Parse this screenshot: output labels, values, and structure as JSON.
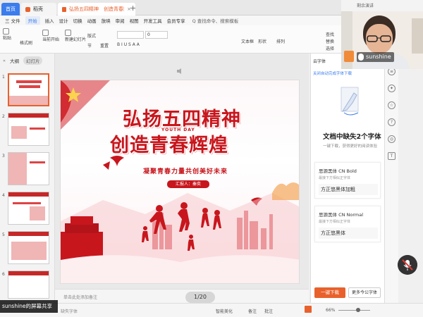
{
  "tabs": {
    "home": "首页",
    "docer": "稻壳",
    "doc": "弘扬五四精神　创造青春辉煌"
  },
  "tab_right": "剩余演讲",
  "menu": [
    "三 文件",
    "开始",
    "插入",
    "设计",
    "切换",
    "动画",
    "放映",
    "审阅",
    "视图",
    "开发工具",
    "会员专享"
  ],
  "menu_search": "Q 查找命令、搜索模板",
  "ribbon": {
    "paste": "粘贴",
    "format_brush": "格式刷",
    "from_current": "当前开始",
    "new_slide": "新建幻灯片",
    "layout": "版式",
    "section": "节",
    "reset": "重置",
    "font_size": "0",
    "textbox": "文本框",
    "shape": "形状",
    "arrange": "排列",
    "find": "查找",
    "replace": "替换",
    "select": "选择"
  },
  "side": {
    "outline": "大纲",
    "slides": "幻灯片"
  },
  "thumb_numbers": [
    "1",
    "2",
    "3",
    "4",
    "5",
    "6"
  ],
  "slide": {
    "title1": "弘扬五四精神",
    "title2": "创造青春辉煌",
    "youth": "YOUTH DAY",
    "subtitle": "凝聚青春力量共创美好未来",
    "reporter": "汇报人：秦奕"
  },
  "note_placeholder": "单击此处添加备注",
  "page_counter": "1/20",
  "status": {
    "missing_font": "缺失字体",
    "beautify": "智能美化",
    "notes": "备注",
    "annot": "批注",
    "zoom": "66%"
  },
  "screen_share": "sunshine的屏幕共享",
  "right_panel": {
    "header": "云字体",
    "link": "关闭自动完成字体下载",
    "title": "文档中缺失2个字体",
    "subtitle": "一键下载，获得更好的阅读体验",
    "fonts": [
      {
        "name": "思源黑体 CN Bold",
        "hint": "最接下方相似正字体",
        "sample": "方正悠黑体加粗"
      },
      {
        "name": "思源黑体 CN Normal",
        "hint": "最接下方相似正字体",
        "sample": "方正悠黑体"
      }
    ],
    "download_button": "一键下载",
    "more_button": "更多今公字体"
  },
  "video": {
    "name": "sunshine"
  }
}
